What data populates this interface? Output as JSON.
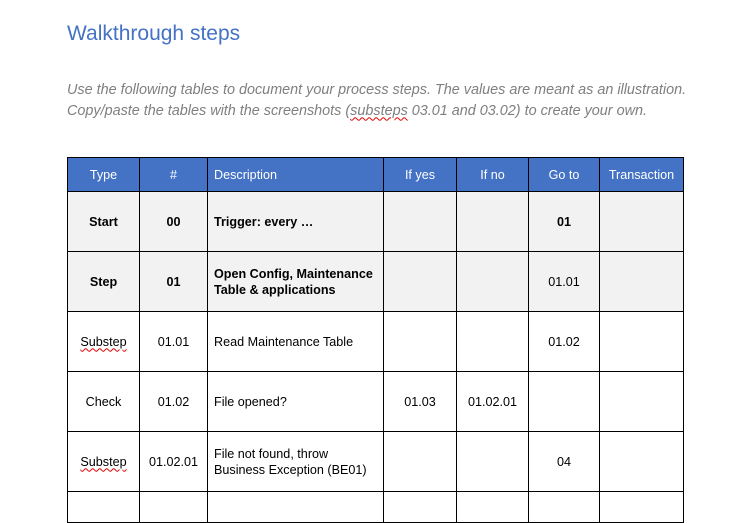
{
  "heading": "Walkthrough steps",
  "intro": {
    "before": "Use the following tables to document your process steps. The values are meant as an illustration. Copy/paste the tables with the screenshots (",
    "misspelled": "substeps",
    "after": " 03.01 and 03.02) to create your own."
  },
  "table": {
    "headers": [
      "Type",
      "#",
      "Description",
      "If yes",
      "If no",
      "Go to",
      "Transaction"
    ],
    "rows": [
      [
        "Start",
        "00",
        "Trigger: every …",
        "",
        "",
        "01",
        ""
      ],
      [
        "Step",
        "01",
        "Open Config, Maintenance Table & applications",
        "",
        "",
        "01.01",
        ""
      ],
      [
        "Substep",
        "01.01",
        "Read Maintenance Table",
        "",
        "",
        "01.02",
        ""
      ],
      [
        "Check",
        "01.02",
        "File opened?",
        "01.03",
        "01.02.01",
        "",
        ""
      ],
      [
        "Substep",
        "01.02.01",
        "File not found, throw Business Exception (BE01)",
        "",
        "",
        "04",
        ""
      ]
    ]
  }
}
